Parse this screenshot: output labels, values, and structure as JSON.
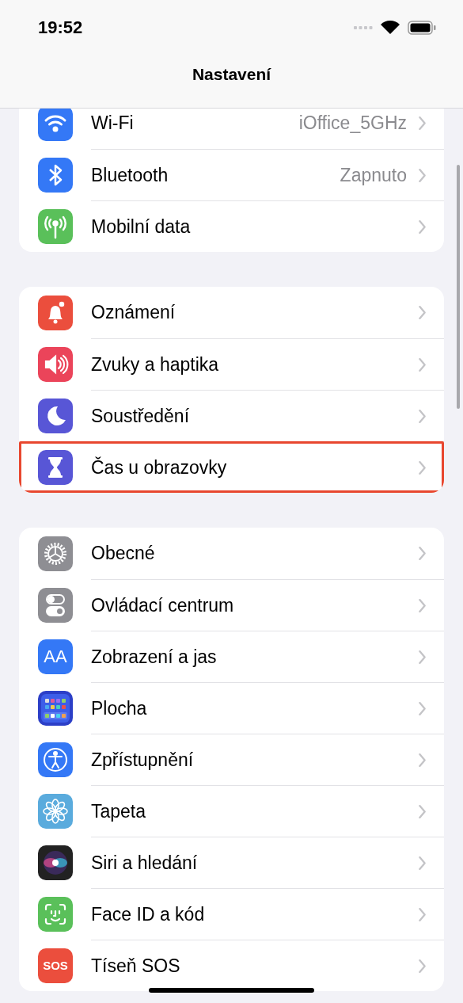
{
  "status_bar": {
    "time": "19:52"
  },
  "nav": {
    "title": "Nastavení"
  },
  "groups": [
    {
      "items": [
        {
          "kind": "wifi",
          "color": "#3478f6",
          "label": "Wi-Fi",
          "value": "iOffice_5GHz",
          "highlighted": false
        },
        {
          "kind": "bluetooth",
          "color": "#3478f6",
          "label": "Bluetooth",
          "value": "Zapnuto",
          "highlighted": false
        },
        {
          "kind": "antenna",
          "color": "#5ac05a",
          "label": "Mobilní data",
          "highlighted": false
        }
      ]
    },
    {
      "items": [
        {
          "kind": "bell",
          "color": "#eb4e3d",
          "label": "Oznámení",
          "highlighted": false
        },
        {
          "kind": "speaker",
          "color": "#eb445a",
          "label": "Zvuky a haptika",
          "highlighted": false
        },
        {
          "kind": "moon",
          "color": "#5856d6",
          "label": "Soustředění",
          "highlighted": false
        },
        {
          "kind": "hourglass",
          "color": "#5856d6",
          "label": "Čas u obrazovky",
          "highlighted": true
        }
      ]
    },
    {
      "items": [
        {
          "kind": "gear",
          "color": "#8e8e93",
          "label": "Obecné",
          "highlighted": false
        },
        {
          "kind": "toggles",
          "color": "#8e8e93",
          "label": "Ovládací centrum",
          "highlighted": false
        },
        {
          "kind": "letters",
          "color": "#3478f6",
          "icon_text": "AA",
          "label": "Zobrazení a jas",
          "highlighted": false
        },
        {
          "kind": "grid",
          "color": "#2c3fc7",
          "label": "Plocha",
          "highlighted": false
        },
        {
          "kind": "figure",
          "color": "#3478f6",
          "label": "Zpřístupnění",
          "highlighted": false
        },
        {
          "kind": "flower",
          "color": "#5aabdd",
          "label": "Tapeta",
          "highlighted": false
        },
        {
          "kind": "orb",
          "color": "#222222",
          "label": "Siri a hledání",
          "highlighted": false
        },
        {
          "kind": "faceid",
          "color": "#5ac05a",
          "label": "Face ID a kód",
          "highlighted": false
        },
        {
          "kind": "letters",
          "color": "#eb4e3d",
          "icon_text": "SOS",
          "label": "Tíseň SOS",
          "highlighted": false
        }
      ]
    }
  ]
}
